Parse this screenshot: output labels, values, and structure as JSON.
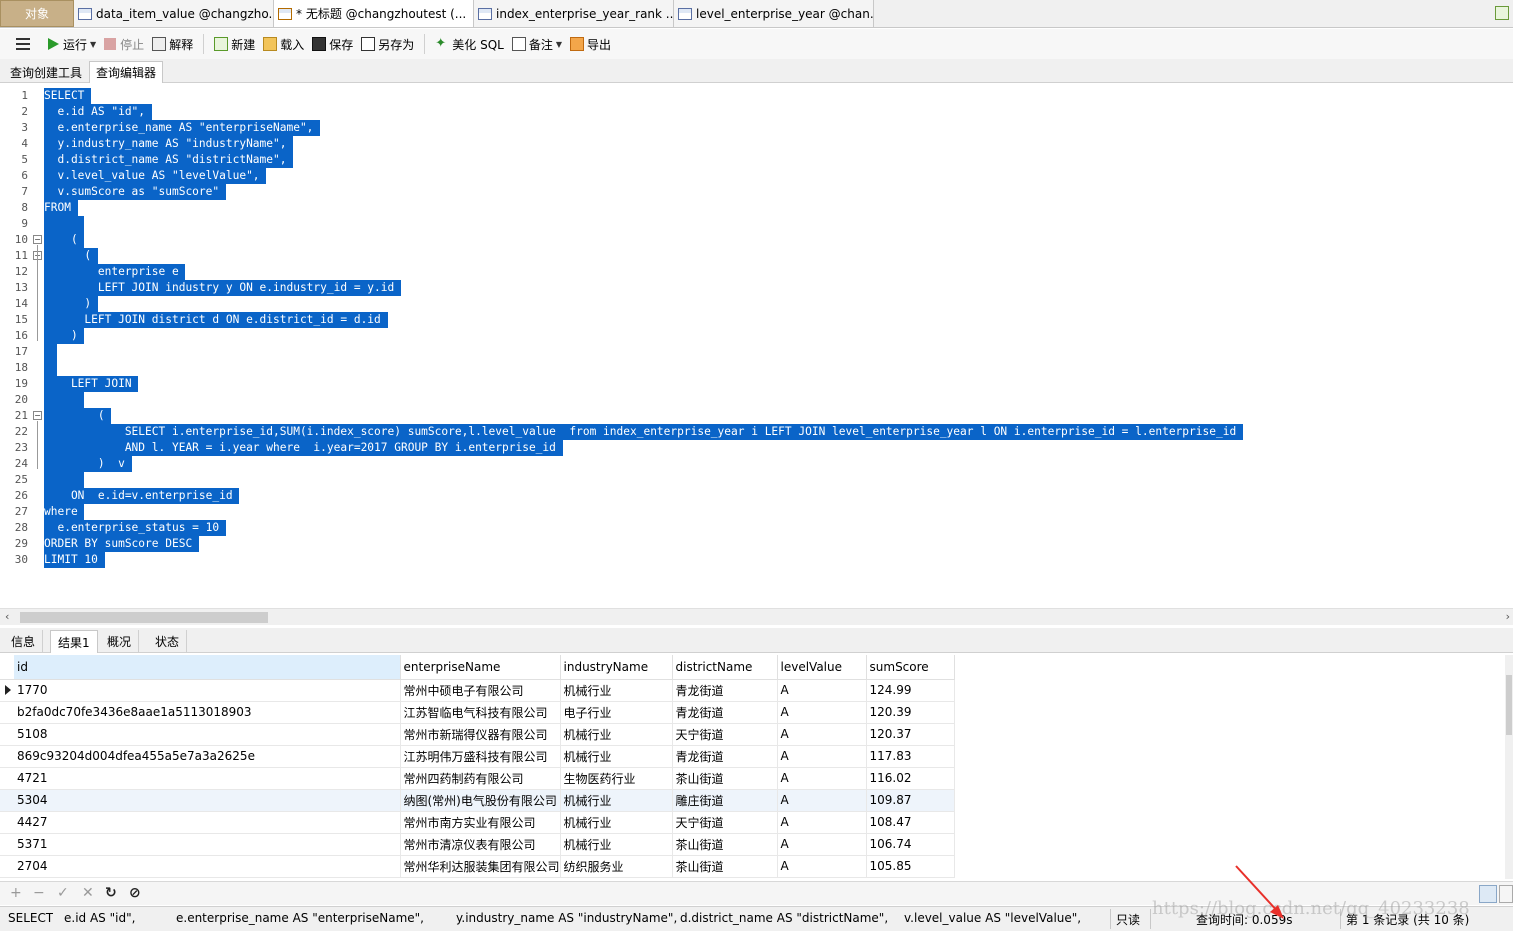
{
  "tabs": [
    {
      "label": "对象"
    },
    {
      "label": "data_item_value @changzho..."
    },
    {
      "label": "* 无标题 @changzhoutest (..."
    },
    {
      "label": "index_enterprise_year_rank ..."
    },
    {
      "label": "level_enterprise_year @chan..."
    }
  ],
  "toolbar": {
    "run": "运行",
    "stop": "停止",
    "explain": "解释",
    "new": "新建",
    "load": "载入",
    "save": "保存",
    "save_as": "另存为",
    "beautify": "美化 SQL",
    "comment": "备注",
    "export": "导出"
  },
  "subtabs": {
    "query_builder": "查询创建工具",
    "query_editor": "查询编辑器"
  },
  "sql_lines": [
    "SELECT",
    "  e.id AS \"id\",",
    "  e.enterprise_name AS \"enterpriseName\",",
    "  y.industry_name AS \"industryName\",",
    "  d.district_name AS \"districtName\",",
    "  v.level_value AS \"levelValue\",",
    "  v.sumScore as \"sumScore\"",
    "FROM",
    "",
    "    (",
    "      (",
    "        enterprise e",
    "        LEFT JOIN industry y ON e.industry_id = y.id",
    "      )",
    "      LEFT JOIN district d ON e.district_id = d.id",
    "    )",
    "",
    "",
    "    LEFT JOIN",
    "",
    "        (",
    "            SELECT i.enterprise_id,SUM(i.index_score) sumScore,l.level_value  from index_enterprise_year i LEFT JOIN level_enterprise_year l ON i.enterprise_id = l.enterprise_id",
    "            AND l. YEAR = i.year where  i.year=2017 GROUP BY i.enterprise_id",
    "        )  v",
    "",
    "    ON  e.id=v.enterprise_id",
    "where",
    "  e.enterprise_status = 10",
    "ORDER BY sumScore DESC",
    "LIMIT 10"
  ],
  "result_tabs": {
    "info": "信息",
    "result": "结果1",
    "profile": "概况",
    "status": "状态"
  },
  "grid": {
    "columns": [
      "id",
      "enterpriseName",
      "industryName",
      "districtName",
      "levelValue",
      "sumScore"
    ],
    "rows": [
      [
        "1770",
        "常州中硕电子有限公司",
        "机械行业",
        "青龙街道",
        "A",
        "124.99"
      ],
      [
        "b2fa0dc70fe3436e8aae1a5113018903",
        "江苏智临电气科技有限公司",
        "电子行业",
        "青龙街道",
        "A",
        "120.39"
      ],
      [
        "5108",
        "常州市新瑞得仪器有限公司",
        "机械行业",
        "天宁街道",
        "A",
        "120.37"
      ],
      [
        "869c93204d004dfea455a5e7a3a2625e",
        "江苏明伟万盛科技有限公司",
        "机械行业",
        "青龙街道",
        "A",
        "117.83"
      ],
      [
        "4721",
        "常州四药制药有限公司",
        "生物医药行业",
        "茶山街道",
        "A",
        "116.02"
      ],
      [
        "5304",
        "纳图(常州)电气股份有限公司",
        "机械行业",
        "雕庄街道",
        "A",
        "109.87"
      ],
      [
        "4427",
        "常州市南方实业有限公司",
        "机械行业",
        "天宁街道",
        "A",
        "108.47"
      ],
      [
        "5371",
        "常州市清凉仪表有限公司",
        "机械行业",
        "茶山街道",
        "A",
        "106.74"
      ],
      [
        "2704",
        "常州华利达服装集团有限公司",
        "纺织服务业",
        "茶山街道",
        "A",
        "105.85"
      ]
    ]
  },
  "statusbar": {
    "sql1": "SELECT",
    "sql2": "e.id AS \"id\",",
    "sql3": "e.enterprise_name AS \"enterpriseName\",",
    "sql4": "y.industry_name AS \"industryName\",",
    "sql5": "d.district_name AS \"districtName\",",
    "sql6": "v.level_value AS \"levelValue\",",
    "readonly": "只读",
    "query_time": "查询时间: 0.059s",
    "records": "第 1 条记录 (共 10 条)"
  },
  "watermark": "https://blog.csdn.net/qq_40233238",
  "colors": {
    "selection": "#0a64c8",
    "arrow": "#e8302a"
  }
}
